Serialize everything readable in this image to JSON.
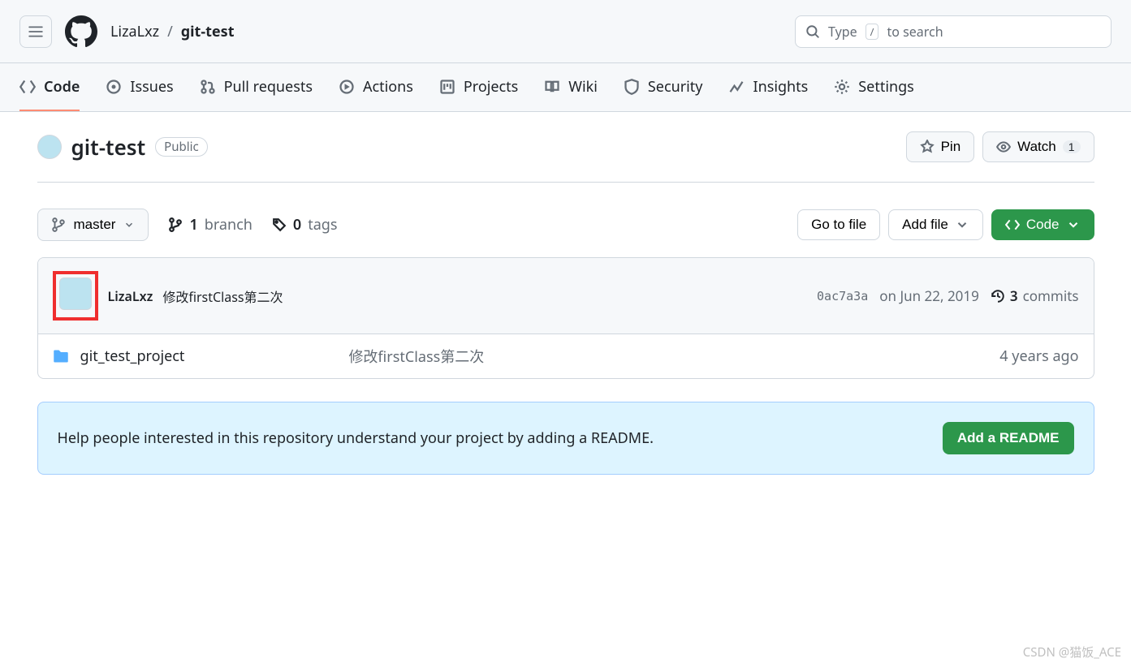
{
  "header": {
    "owner": "LizaLxz",
    "repo": "git-test",
    "separator": "/",
    "search_prefix": "Type",
    "search_key": "/",
    "search_suffix": "to search"
  },
  "tabs": [
    {
      "label": "Code"
    },
    {
      "label": "Issues"
    },
    {
      "label": "Pull requests"
    },
    {
      "label": "Actions"
    },
    {
      "label": "Projects"
    },
    {
      "label": "Wiki"
    },
    {
      "label": "Security"
    },
    {
      "label": "Insights"
    },
    {
      "label": "Settings"
    }
  ],
  "repo": {
    "name": "git-test",
    "visibility": "Public",
    "pin": "Pin",
    "watch": "Watch",
    "watch_count": "1"
  },
  "file_nav": {
    "branch": "master",
    "branch_count": "1",
    "branch_label": "branch",
    "tag_count": "0",
    "tag_label": "tags",
    "go_to_file": "Go to file",
    "add_file": "Add file",
    "code": "Code"
  },
  "latest_commit": {
    "author": "LizaLxz",
    "message": "修改firstClass第二次",
    "sha": "0ac7a3a",
    "date": "on Jun 22, 2019",
    "commit_count": "3",
    "commits_label": "commits"
  },
  "files": [
    {
      "name": "git_test_project",
      "message": "修改firstClass第二次",
      "age": "4 years ago"
    }
  ],
  "readme": {
    "prompt": "Help people interested in this repository understand your project by adding a README.",
    "button": "Add a README"
  },
  "watermark": "CSDN @猫饭_ACE"
}
